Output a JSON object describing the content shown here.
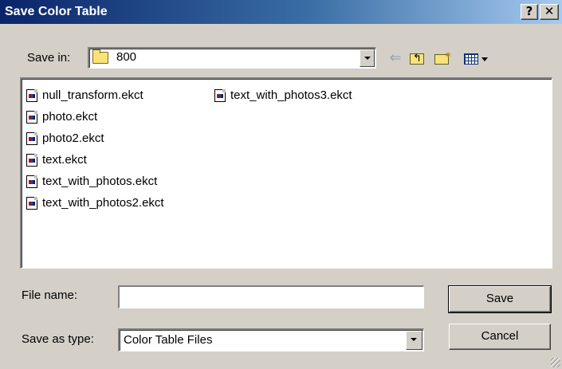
{
  "window": {
    "title": "Save Color Table",
    "help_label": "?",
    "close_label": "✕"
  },
  "save_in": {
    "label": "Save in:",
    "value": "800",
    "icon": "folder-icon"
  },
  "toolbar": {
    "back_icon": "back-arrow-icon",
    "up_icon": "up-one-level-icon",
    "new_folder_icon": "create-new-folder-icon",
    "view_icon": "view-menu-icon",
    "back_glyph": "⇐"
  },
  "files": [
    {
      "name": "null_transform.ekct"
    },
    {
      "name": "photo.ekct"
    },
    {
      "name": "photo2.ekct"
    },
    {
      "name": "text.ekct"
    },
    {
      "name": "text_with_photos.ekct"
    },
    {
      "name": "text_with_photos2.ekct"
    },
    {
      "name": "text_with_photos3.ekct"
    }
  ],
  "file_name": {
    "label": "File name:",
    "value": ""
  },
  "save_as_type": {
    "label": "Save as type:",
    "value": "Color Table Files"
  },
  "buttons": {
    "save": "Save",
    "cancel": "Cancel"
  },
  "colors": {
    "titlebar_start": "#0a246a",
    "titlebar_end": "#a6caf0",
    "dialog_bg": "#d4d0c8"
  }
}
